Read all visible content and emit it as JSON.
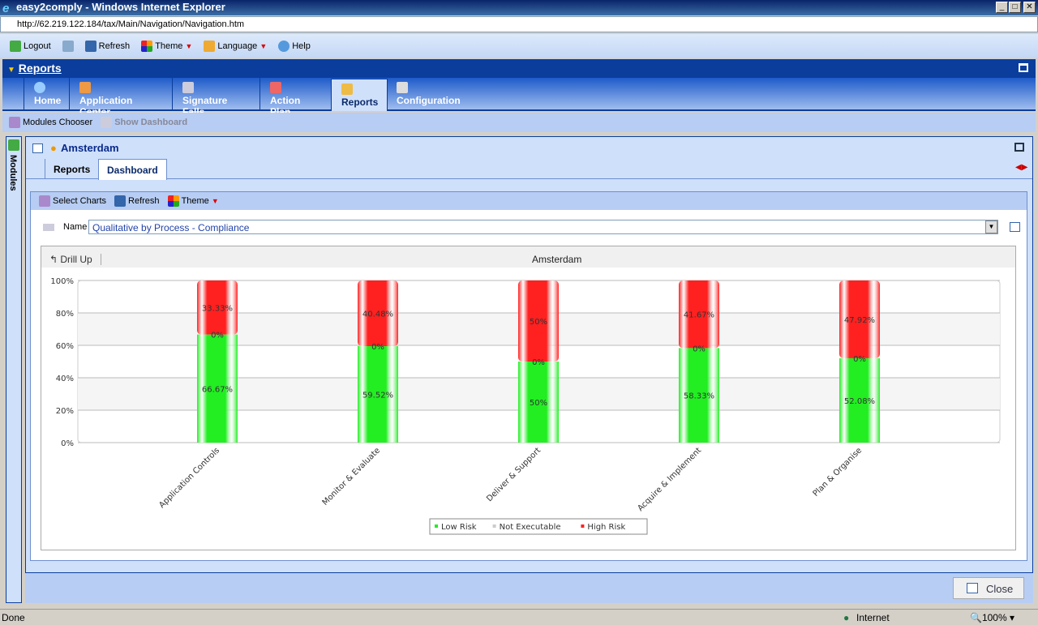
{
  "window": {
    "title": "easy2comply - Windows Internet Explorer",
    "url": "http://62.219.122.184/tax/Main/Navigation/Navigation.htm"
  },
  "toolbar": {
    "logout": "Logout",
    "refresh": "Refresh",
    "theme": "Theme",
    "language": "Language",
    "help": "Help"
  },
  "section": {
    "title": "Reports"
  },
  "nav": {
    "tabs": [
      "Home",
      "Application Center",
      "Signature Falls",
      "Action Plan",
      "Reports",
      "Configuration"
    ],
    "active": "Reports"
  },
  "subtoolbar": {
    "modules_chooser": "Modules Chooser",
    "show_dashboard": "Show Dashboard"
  },
  "sidebar": {
    "label": "Modules"
  },
  "panel": {
    "title": "Amsterdam",
    "tabs": [
      "Reports",
      "Dashboard"
    ],
    "active_tab": "Dashboard"
  },
  "dash_toolbar": {
    "select_charts": "Select Charts",
    "refresh": "Refresh",
    "theme": "Theme"
  },
  "name_field": {
    "label": "Name",
    "value": "Qualitative by Process - Compliance"
  },
  "chart_header": {
    "drill_up": "Drill Up",
    "title": "Amsterdam"
  },
  "chart_data": {
    "type": "bar",
    "stacked": true,
    "title": "Amsterdam",
    "categories": [
      "Application Controls",
      "Monitor & Evaluate",
      "Deliver & Support",
      "Acquire & Implement",
      "Plan & Organise"
    ],
    "series": [
      {
        "name": "Low Risk",
        "color": "#22ee22",
        "values": [
          66.67,
          59.52,
          50,
          58.33,
          52.08
        ],
        "labels": [
          "66.67%",
          "59.52%",
          "50%",
          "58.33%",
          "52.08%"
        ]
      },
      {
        "name": "Not Executable",
        "color": "#cccccc",
        "values": [
          0,
          0,
          0,
          0,
          0
        ],
        "labels": [
          "0%",
          "0%",
          "0%",
          "0%",
          "0%"
        ]
      },
      {
        "name": "High Risk",
        "color": "#ff2020",
        "values": [
          33.33,
          40.48,
          50,
          41.67,
          47.92
        ],
        "labels": [
          "33.33%",
          "40.48%",
          "50%",
          "41.67%",
          "47.92%"
        ]
      }
    ],
    "yticks": [
      "0%",
      "20%",
      "40%",
      "60%",
      "80%",
      "100%"
    ],
    "ylim": [
      0,
      100
    ],
    "grid": true,
    "legend": "bottom"
  },
  "footer": {
    "close": "Close"
  },
  "status": {
    "left": "Done",
    "zone": "Internet",
    "zoom": "100%"
  }
}
